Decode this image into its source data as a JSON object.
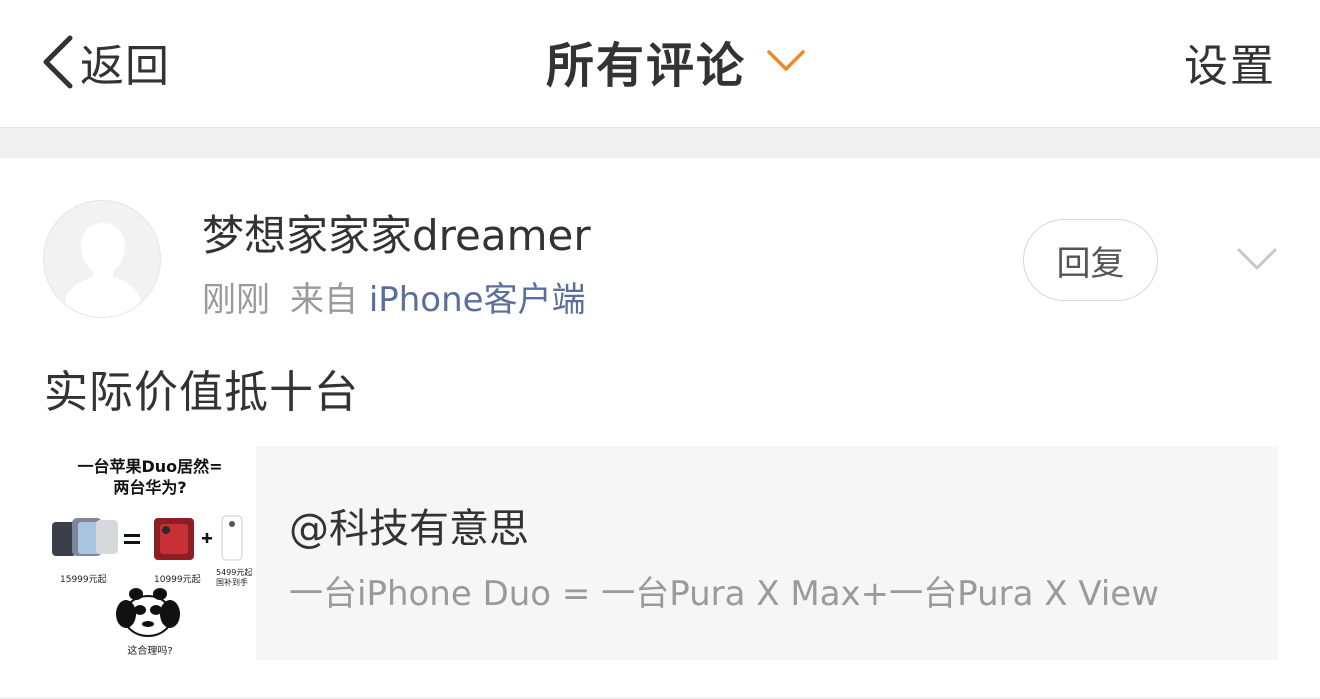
{
  "header": {
    "back_label": "返回",
    "title": "所有评论",
    "settings_label": "设置",
    "accent_color": "#f08a24"
  },
  "comment": {
    "username": "梦想家家家dreamer",
    "time": "刚刚",
    "from_prefix": "来自",
    "source": "iPhone客户端",
    "reply_label": "回复",
    "text": "实际价值抵十台"
  },
  "quote_card": {
    "title": "@科技有意思",
    "description": "一台iPhone Duo = 一台Pura X Max+一台Pura X View",
    "thumbnail": {
      "headline_line1": "一台苹果Duo居然=",
      "headline_line2": "两台华为?",
      "price_left": "15999元起",
      "price_mid": "10999元起",
      "price_right_line1": "5499元起",
      "price_right_line2": "国补到手",
      "caption": "这合理吗?"
    }
  }
}
